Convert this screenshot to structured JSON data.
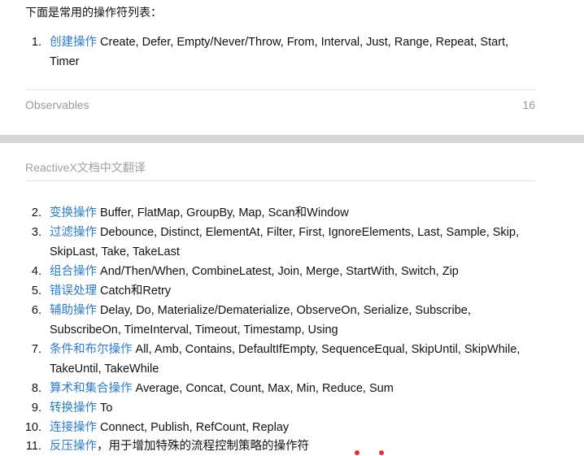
{
  "intro": "下面是常用的操作符列表：",
  "page1": {
    "items": [
      {
        "num": "1.",
        "cat": "创建操作",
        "ops": " Create, Defer, Empty/Never/Throw, From, Interval, Just, Range, Repeat, Start, Timer"
      }
    ],
    "footer_title": "Observables",
    "footer_page": "16"
  },
  "page2": {
    "header": "ReactiveX文档中文翻译",
    "items": [
      {
        "num": "2.",
        "cat": "变换操作",
        "ops": " Buffer, FlatMap, GroupBy, Map, Scan和Window"
      },
      {
        "num": "3.",
        "cat": "过滤操作",
        "ops": " Debounce, Distinct, ElementAt, Filter, First, IgnoreElements, Last, Sample, Skip, SkipLast, Take, TakeLast"
      },
      {
        "num": "4.",
        "cat": "组合操作",
        "ops": " And/Then/When, CombineLatest, Join, Merge, StartWith, Switch, Zip"
      },
      {
        "num": "5.",
        "cat": "错误处理",
        "ops": " Catch和Retry"
      },
      {
        "num": "6.",
        "cat": "辅助操作",
        "ops": " Delay, Do, Materialize/Dematerialize, ObserveOn, Serialize, Subscribe, SubscribeOn, TimeInterval, Timeout, Timestamp, Using"
      },
      {
        "num": "7.",
        "cat": "条件和布尔操作",
        "ops": " All, Amb, Contains, DefaultIfEmpty, SequenceEqual, SkipUntil, SkipWhile, TakeUntil, TakeWhile"
      },
      {
        "num": "8.",
        "cat": "算术和集合操作",
        "ops": " Average, Concat, Count, Max, Min, Reduce, Sum"
      },
      {
        "num": "9.",
        "cat": "转换操作",
        "ops": " To"
      },
      {
        "num": "10.",
        "cat": "连接操作",
        "ops": " Connect, Publish, RefCount, Replay"
      },
      {
        "num": "11.",
        "cat": "反压操作",
        "ops": "，用于增加特殊的流程控制策略的操作符"
      }
    ]
  },
  "colors": {
    "link": "#2e7cc7",
    "muted": "#9a9a9a",
    "gap": "#d5d5d5"
  }
}
